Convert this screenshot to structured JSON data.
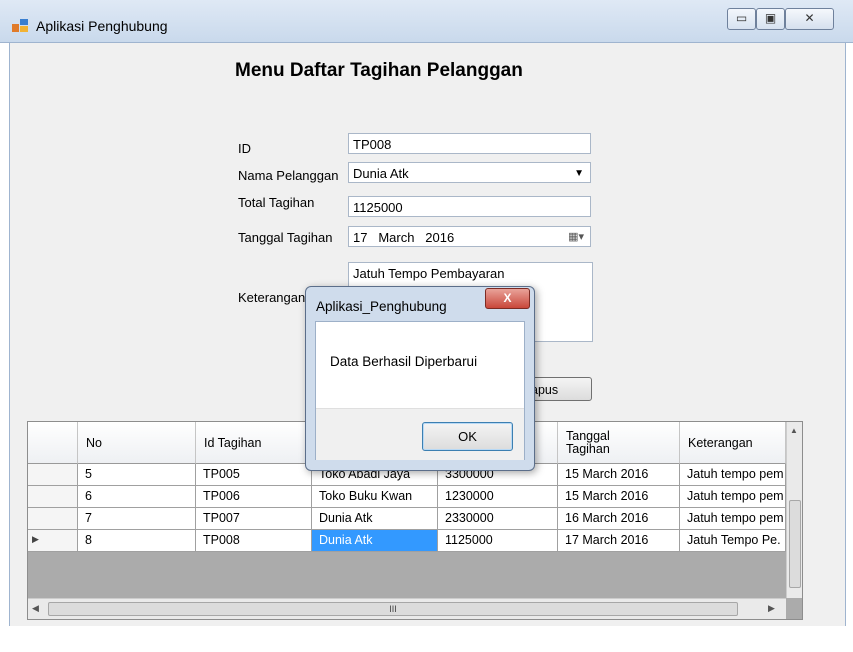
{
  "window": {
    "title": "Aplikasi Penghubung",
    "minimize": "▭",
    "maximize": "▣",
    "close": "✕"
  },
  "form": {
    "heading": "Menu Daftar Tagihan Pelanggan",
    "labels": {
      "id": "ID",
      "nama": "Nama Pelanggan",
      "total": "Total Tagihan",
      "tanggal": "Tanggal Tagihan",
      "keterangan": "Keterangan"
    },
    "values": {
      "id": "TP008",
      "nama": "Dunia Atk",
      "total": "1125000",
      "tanggal_day": "17",
      "tanggal_month": "March",
      "tanggal_year": "2016",
      "keterangan": "Jatuh Tempo Pembayaran"
    },
    "partial_button": "apus"
  },
  "grid": {
    "columns": [
      "No",
      "Id Tagihan",
      "",
      "",
      "Tanggal Tagihan",
      "Keterangan"
    ],
    "rows": [
      [
        "5",
        "TP005",
        "Toko Abadi Jaya",
        "3300000",
        "15 March 2016",
        "Jatuh tempo pem"
      ],
      [
        "6",
        "TP006",
        "Toko Buku Kwan",
        "1230000",
        "15 March 2016",
        "Jatuh tempo pem"
      ],
      [
        "7",
        "TP007",
        "Dunia Atk",
        "2330000",
        "16 March 2016",
        "Jatuh tempo pem"
      ],
      [
        "8",
        "TP008",
        "Dunia Atk",
        "1125000",
        "17 March 2016",
        "Jatuh Tempo Pe."
      ]
    ],
    "hscroll_thumb": "III"
  },
  "dialog": {
    "title": "Aplikasi_Penghubung",
    "message": "Data Berhasil Diperbarui",
    "ok": "OK",
    "close": "X"
  },
  "colors": {
    "selection": "#3399ff",
    "close_red": "#d9534f"
  }
}
